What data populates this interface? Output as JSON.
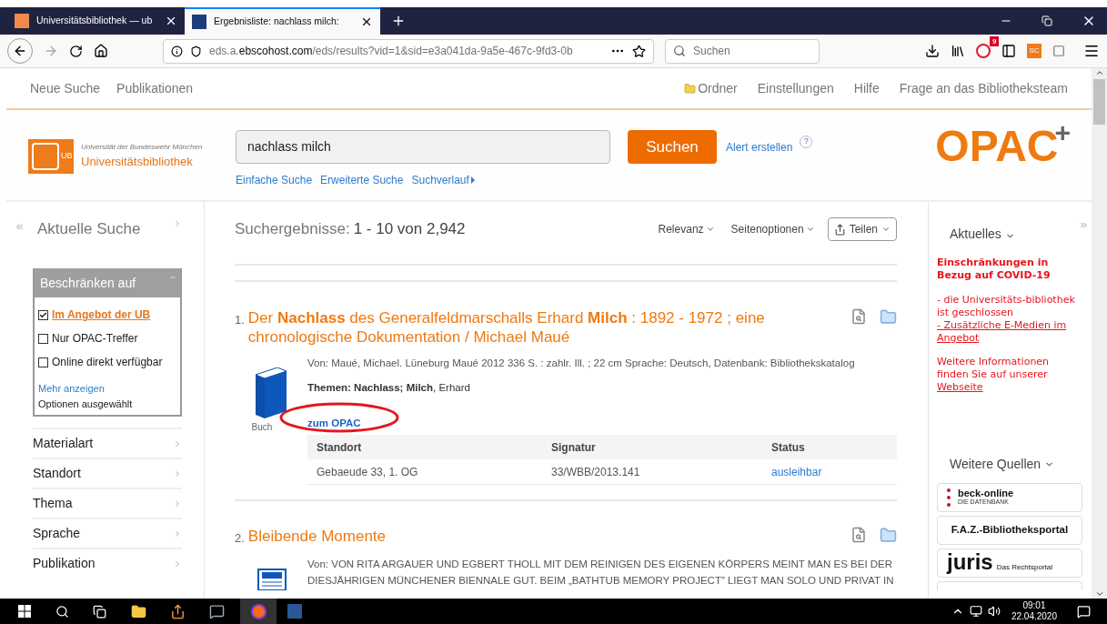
{
  "browser": {
    "tabs": [
      {
        "title": "Universitätsbibliothek — ub",
        "kind": "ub",
        "selected": false
      },
      {
        "title": "Ergebnisliste: nachlass milch:",
        "kind": "ebsco",
        "selected": true
      }
    ],
    "url": {
      "prefix": "eds.a.",
      "domain": "ebscohost.com",
      "path": "/eds/results?vid=1&sid=e3a041da-9a5e-467c-9fd3-0b"
    },
    "search_placeholder": "Suchen",
    "notification_badge": "9",
    "extension_label": "SC"
  },
  "top_nav": {
    "left": [
      "Neue Suche",
      "Publikationen"
    ],
    "right": [
      {
        "label": "Ordner",
        "kind": "folder"
      },
      {
        "label": "Einstellungen",
        "kind": "link"
      },
      {
        "label": "Hilfe",
        "kind": "link"
      },
      {
        "label": "Frage an das Bibliotheksteam",
        "kind": "link"
      }
    ]
  },
  "header": {
    "logo": {
      "subtitle": "Universität der Bundeswehr München",
      "title": "Universitätsbibliothek",
      "badge": "UB"
    },
    "search": {
      "value": "nachlass milch"
    },
    "search_button": "Suchen",
    "alert_link": "Alert erstellen",
    "help": "?",
    "links": [
      {
        "label": "Einfache Suche",
        "caret": false
      },
      {
        "label": "Erweiterte Suche",
        "caret": false
      },
      {
        "label": "Suchverlauf",
        "caret": true
      }
    ],
    "brand": {
      "text": "OPAC",
      "sup": "+"
    }
  },
  "sidebar": {
    "title": "Aktuelle Suche",
    "limit_panel": {
      "title": "Beschränken auf",
      "filters": [
        {
          "label": "Im Angebot der UB",
          "checked": true
        },
        {
          "label": "Nur OPAC-Treffer",
          "checked": false
        },
        {
          "label": "Online direkt verfügbar",
          "checked": false
        }
      ],
      "more_link": "Mehr anzeigen",
      "selected_note": "Optionen ausgewählt"
    },
    "facets": [
      "Materialart",
      "Standort",
      "Thema",
      "Sprache",
      "Publikation"
    ]
  },
  "results": {
    "label": "Suchergebnisse:",
    "range": "1 - 10 von 2,942",
    "sort": "Relevanz",
    "page_options": "Seitenoptionen",
    "share": "Teilen",
    "items": [
      {
        "number": "1.",
        "title": "Der **Nachlass** des Generalfeldmarschalls Erhard **Milch** : 1892 - 1972 ; eine chronologische Dokumentation / Michael Maué",
        "kind": "book",
        "type_label": "Buch",
        "meta_lines": [
          "Von: Maué, Michael. Lüneburg Maué 2012 336 S. : zahlr. Ill. ; 22 cm Sprache: Deutsch, Datenbank: Bibliothekskatalog"
        ],
        "subjects": "**Themen: Nachlass; Milch**, Erhard",
        "link": "zum OPAC",
        "annotated": true,
        "holdings": {
          "columns": [
            "Standort",
            "Signatur",
            "Status"
          ],
          "rows": [
            [
              "Gebaeude 33, 1. OG",
              "33/WBB/2013.141",
              "ausleihbar"
            ]
          ]
        }
      },
      {
        "number": "2.",
        "title": "Bleibende Momente",
        "kind": "newspaper",
        "meta_lines": [
          "Von: VON RITA ARGAUER UND EGBERT THOLL MIT DEM REINIGEN DES EIGENEN KÖRPERS MEINT MAN ES BEI DER",
          "DIESJÄHRIGEN MÜNCHENER BIENNALE GUT. BEIM „BATHTUB MEMORY PROJECT” LIEGT MAN SOLO UND PRIVAT IN"
        ]
      }
    ]
  },
  "right_panel": {
    "news_title": "Aktuelles",
    "news": [
      {
        "kind": "heading",
        "text": "Einschränkungen in Bezug auf COVID-19"
      },
      {
        "kind": "text",
        "text": "- die Universitäts-bibliothek ist geschlossen"
      },
      {
        "kind": "link",
        "text": "- Zusätzliche E-Medien im Angebot"
      },
      {
        "kind": "text_link",
        "text": "Weitere Informationen finden Sie auf unserer",
        "link": "Webseite"
      }
    ],
    "sources_title": "Weitere Quellen",
    "sources": [
      {
        "kind": "beck",
        "name": "beck-online",
        "tagline": "DIE DATENBANK"
      },
      {
        "kind": "faz",
        "name": "F.A.Z.-Bibliotheksportal"
      },
      {
        "kind": "juris",
        "name": "juris",
        "tagline": "Das Rechtsportal"
      }
    ]
  },
  "taskbar": {
    "time": "09:01",
    "date": "22.04.2020"
  }
}
